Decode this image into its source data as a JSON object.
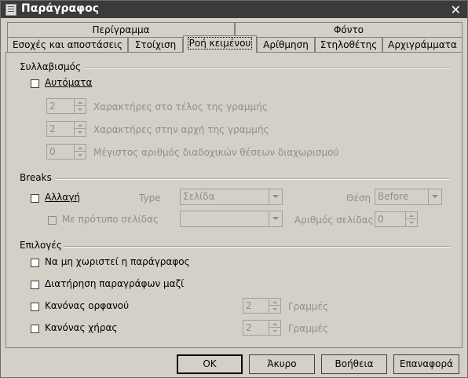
{
  "window": {
    "title": "Παράγραφος"
  },
  "tabs_back": [
    {
      "label": "Περίγραμμα"
    },
    {
      "label": "Φόντο"
    }
  ],
  "tabs_front": [
    {
      "label": "Εσοχές και αποστάσεις"
    },
    {
      "label": "Στοίχιση"
    },
    {
      "label": "Ροή κειμένου",
      "active": true
    },
    {
      "label": "Αρίθμηση"
    },
    {
      "label": "Στηλοθέτης"
    },
    {
      "label": "Αρχιγράμματα"
    }
  ],
  "hyphenation": {
    "heading": "Συλλαβισμός",
    "auto_label": "Αυτόματα",
    "fields": [
      {
        "value": "2",
        "label": "Χαρακτήρες στο τέλος της γραμμής"
      },
      {
        "value": "2",
        "label": "Χαρακτήρες στην αρχή της γραμμής"
      },
      {
        "value": "0",
        "label": "Μέγιστος αριθμός διαδοχικών θέσεων διαχωρισμού"
      }
    ]
  },
  "breaks": {
    "heading": "Breaks",
    "insert_label": "Αλλαγή",
    "type_label": "Type",
    "type_value": "Σελίδα",
    "position_label": "Θέση",
    "position_value": "Before",
    "with_style_label": "Με πρότυπο σελίδας",
    "style_value": "",
    "page_number_label": "Αριθμός σελίδας",
    "page_number_value": "0"
  },
  "options": {
    "heading": "Επιλογές",
    "dont_split": "Να μη χωριστεί η παράγραφος",
    "keep_next": "Διατήρηση παραγράφων μαζί",
    "orphan": "Κανόνας ορφανού",
    "orphan_value": "2",
    "orphan_unit": "Γραμμές",
    "widow": "Κανόνας χήρας",
    "widow_value": "2",
    "widow_unit": "Γραμμές"
  },
  "buttons": {
    "ok": "OK",
    "cancel": "Άκυρο",
    "help": "Βοήθεια",
    "reset": "Επαναφορά"
  }
}
